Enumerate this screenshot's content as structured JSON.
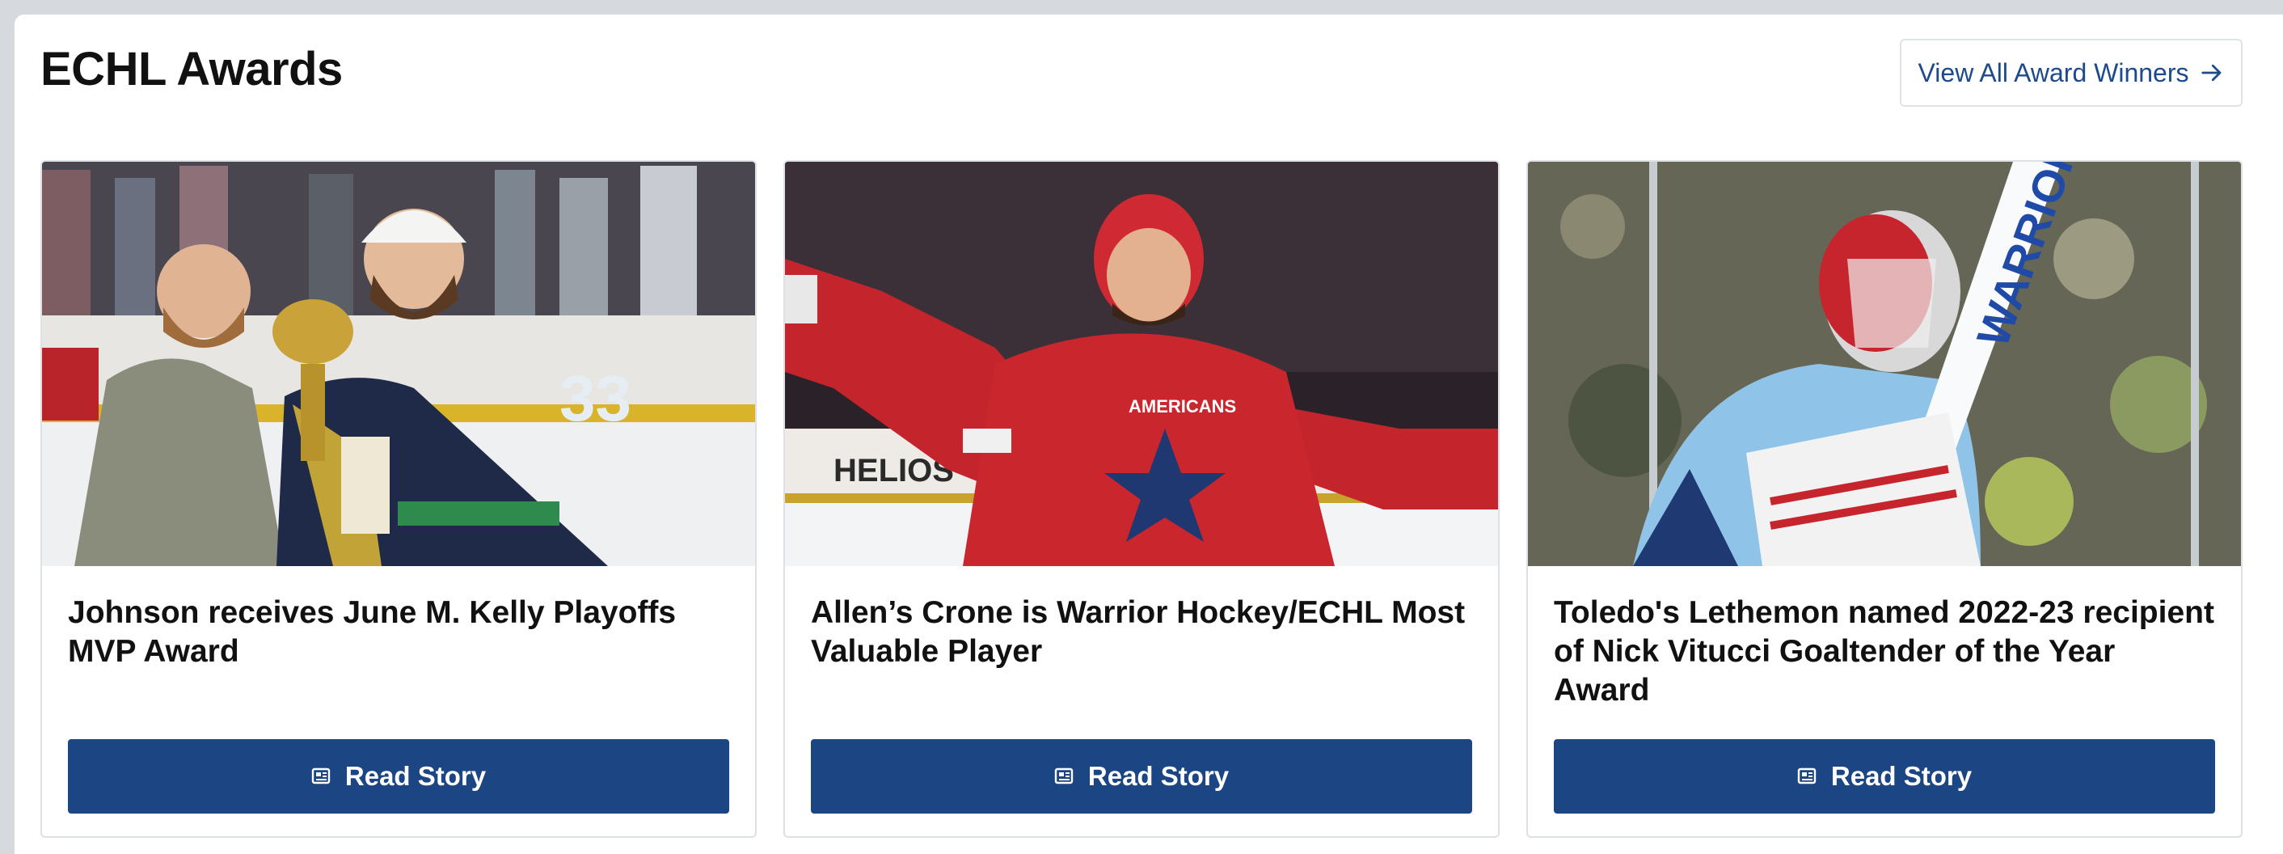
{
  "section": {
    "title": "ECHL Awards",
    "view_all_label": "View All Award Winners"
  },
  "cards": [
    {
      "headline": "Johnson receives June M. Kelly Playoffs MVP Award",
      "button_label": "Read Story",
      "photo_icon": "trophy-presentation-photo"
    },
    {
      "headline": "Allen’s Crone is Warrior Hockey/ECHL Most Valuable Player",
      "button_label": "Read Story",
      "photo_icon": "celebrating-player-photo"
    },
    {
      "headline": "Toledo's Lethemon named 2022-23 recipient of Nick Vitucci Goaltender of the Year Award",
      "button_label": "Read Story",
      "photo_icon": "goaltender-photo"
    }
  ],
  "colors": {
    "accent": "#1c4584",
    "link": "#1c4a8c",
    "background": "#d6dadf"
  }
}
